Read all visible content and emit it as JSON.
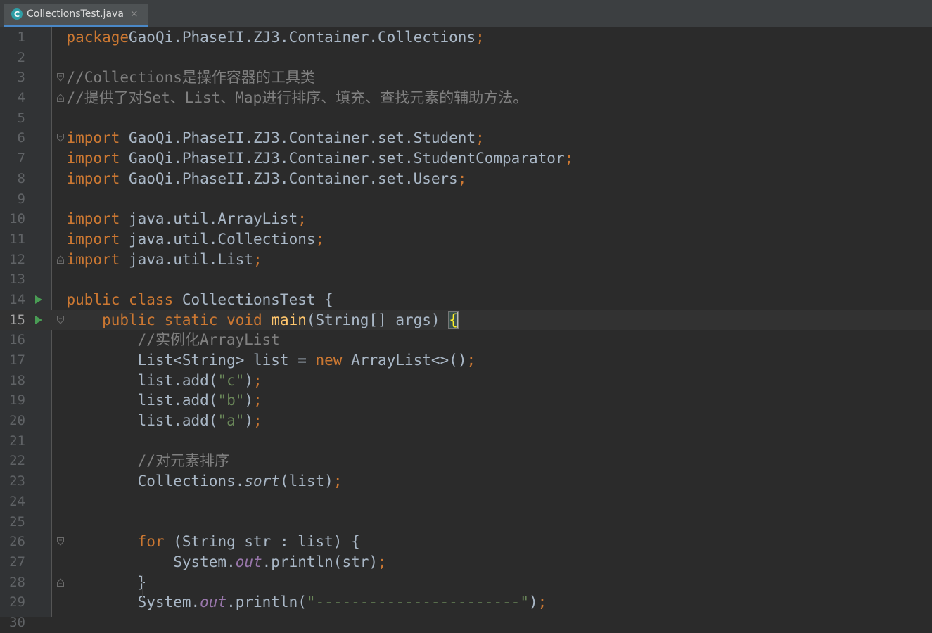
{
  "tab": {
    "icon": "java-class-icon",
    "icon_glyph": "C",
    "title": "CollectionsTest.java",
    "close": "×"
  },
  "editor": {
    "current_line": 15,
    "lines": [
      {
        "n": "1",
        "tokens": [
          [
            "kw",
            "package"
          ],
          [
            "",
            "GaoQi.PhaseII.ZJ3.Container.Collections"
          ],
          [
            "kw",
            ";"
          ]
        ]
      },
      {
        "n": "2",
        "tokens": []
      },
      {
        "n": "3",
        "fold": "start",
        "tokens": [
          [
            "cm",
            "//Collections是操作容器的工具类"
          ]
        ]
      },
      {
        "n": "4",
        "fold": "end",
        "tokens": [
          [
            "cm",
            "//提供了对Set、List、Map进行排序、填充、查找元素的辅助方法。"
          ]
        ]
      },
      {
        "n": "5",
        "tokens": []
      },
      {
        "n": "6",
        "fold": "start",
        "tokens": [
          [
            "kw",
            "import"
          ],
          [
            "",
            " GaoQi.PhaseII.ZJ3.Container.set.Student"
          ],
          [
            "kw",
            ";"
          ]
        ]
      },
      {
        "n": "7",
        "tokens": [
          [
            "kw",
            "import"
          ],
          [
            "",
            " GaoQi.PhaseII.ZJ3.Container.set.StudentComparator"
          ],
          [
            "kw",
            ";"
          ]
        ]
      },
      {
        "n": "8",
        "tokens": [
          [
            "kw",
            "import"
          ],
          [
            "",
            " GaoQi.PhaseII.ZJ3.Container.set.Users"
          ],
          [
            "kw",
            ";"
          ]
        ]
      },
      {
        "n": "9",
        "tokens": []
      },
      {
        "n": "10",
        "tokens": [
          [
            "kw",
            "import"
          ],
          [
            "",
            " java.util.ArrayList"
          ],
          [
            "kw",
            ";"
          ]
        ]
      },
      {
        "n": "11",
        "tokens": [
          [
            "kw",
            "import"
          ],
          [
            "",
            " java.util.Collections"
          ],
          [
            "kw",
            ";"
          ]
        ]
      },
      {
        "n": "12",
        "fold": "end",
        "tokens": [
          [
            "kw",
            "import"
          ],
          [
            "",
            " java.util.List"
          ],
          [
            "kw",
            ";"
          ]
        ]
      },
      {
        "n": "13",
        "tokens": []
      },
      {
        "n": "14",
        "run": true,
        "tokens": [
          [
            "kw",
            "public class"
          ],
          [
            "",
            " CollectionsTest {"
          ]
        ]
      },
      {
        "n": "15",
        "run": true,
        "fold": "start",
        "tokens": [
          [
            "",
            "    "
          ],
          [
            "kw",
            "public static void"
          ],
          [
            "",
            " "
          ],
          [
            "fn",
            "main"
          ],
          [
            "",
            "(String[] args) "
          ],
          [
            "br",
            "{"
          ],
          [
            "cursor",
            ""
          ]
        ]
      },
      {
        "n": "16",
        "tokens": [
          [
            "",
            "        "
          ],
          [
            "cm",
            "//实例化ArrayList"
          ]
        ]
      },
      {
        "n": "17",
        "tokens": [
          [
            "",
            "        List<String> list = "
          ],
          [
            "kw",
            "new"
          ],
          [
            "",
            " ArrayList<>()"
          ],
          [
            "kw",
            ";"
          ]
        ]
      },
      {
        "n": "18",
        "tokens": [
          [
            "",
            "        list.add("
          ],
          [
            "st",
            "\"c\""
          ],
          [
            "",
            ")"
          ],
          [
            "kw",
            ";"
          ]
        ]
      },
      {
        "n": "19",
        "tokens": [
          [
            "",
            "        list.add("
          ],
          [
            "st",
            "\"b\""
          ],
          [
            "",
            ")"
          ],
          [
            "kw",
            ";"
          ]
        ]
      },
      {
        "n": "20",
        "tokens": [
          [
            "",
            "        list.add("
          ],
          [
            "st",
            "\"a\""
          ],
          [
            "",
            ")"
          ],
          [
            "kw",
            ";"
          ]
        ]
      },
      {
        "n": "21",
        "tokens": []
      },
      {
        "n": "22",
        "tokens": [
          [
            "",
            "        "
          ],
          [
            "cm",
            "//对元素排序"
          ]
        ]
      },
      {
        "n": "23",
        "tokens": [
          [
            "",
            "        Collections."
          ],
          [
            "it",
            "sort"
          ],
          [
            "",
            "(list)"
          ],
          [
            "kw",
            ";"
          ]
        ]
      },
      {
        "n": "24",
        "tokens": []
      },
      {
        "n": "25",
        "tokens": []
      },
      {
        "n": "26",
        "fold": "start",
        "tokens": [
          [
            "",
            "        "
          ],
          [
            "kw",
            "for"
          ],
          [
            "",
            " (String str : list) {"
          ]
        ]
      },
      {
        "n": "27",
        "tokens": [
          [
            "",
            "            System."
          ],
          [
            "fd",
            "out"
          ],
          [
            "",
            ".println(str)"
          ],
          [
            "kw",
            ";"
          ]
        ]
      },
      {
        "n": "28",
        "fold": "end",
        "tokens": [
          [
            "",
            "        }"
          ]
        ]
      },
      {
        "n": "29",
        "tokens": [
          [
            "",
            "        System."
          ],
          [
            "fd",
            "out"
          ],
          [
            "",
            ".println("
          ],
          [
            "st",
            "\"-----------------------\""
          ],
          [
            "",
            ")"
          ],
          [
            "kw",
            ";"
          ]
        ]
      },
      {
        "n": "30",
        "tokens": []
      }
    ]
  }
}
